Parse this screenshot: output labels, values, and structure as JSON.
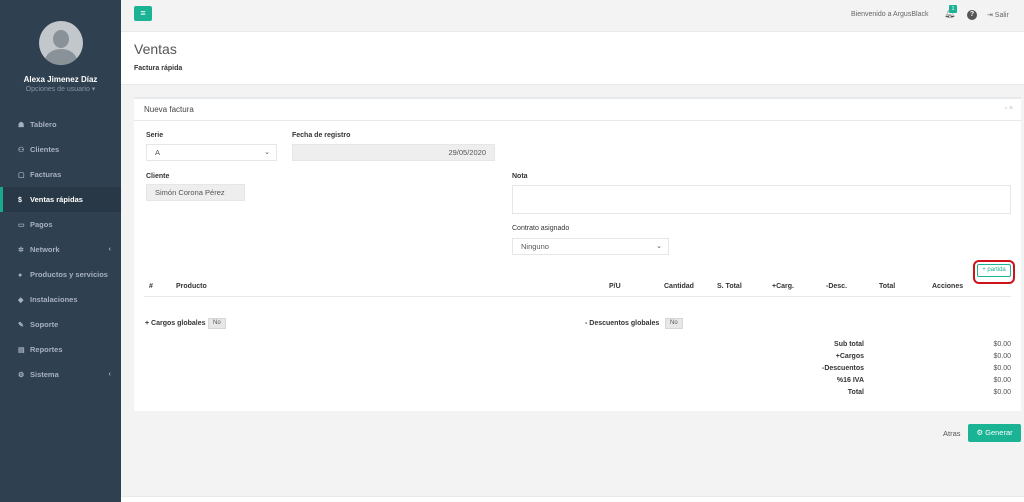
{
  "user": {
    "name": "Alexa Jimenez Díaz",
    "options": "Opciones de usuario ▾"
  },
  "nav": [
    {
      "icon": "☗",
      "label": "Tablero",
      "active": false,
      "arrow": ""
    },
    {
      "icon": "⚇",
      "label": "Clientes",
      "active": false,
      "arrow": ""
    },
    {
      "icon": "▢",
      "label": "Facturas",
      "active": false,
      "arrow": ""
    },
    {
      "icon": "$",
      "label": "Ventas rápidas",
      "active": true,
      "arrow": ""
    },
    {
      "icon": "▭",
      "label": "Pagos",
      "active": false,
      "arrow": ""
    },
    {
      "icon": "✲",
      "label": "Network",
      "active": false,
      "arrow": "‹"
    },
    {
      "icon": "●",
      "label": "Productos y servicios",
      "active": false,
      "arrow": ""
    },
    {
      "icon": "◆",
      "label": "Instalaciones",
      "active": false,
      "arrow": ""
    },
    {
      "icon": "✎",
      "label": "Soporte",
      "active": false,
      "arrow": ""
    },
    {
      "icon": "▤",
      "label": "Reportes",
      "active": false,
      "arrow": ""
    },
    {
      "icon": "⚙",
      "label": "Sistema",
      "active": false,
      "arrow": "‹"
    }
  ],
  "topbar": {
    "menu_icon": "≡",
    "welcome": "Bienvenido a ArgusBlack",
    "badge": "1",
    "help": "?",
    "logout": "⇥ Salir"
  },
  "header": {
    "title": "Ventas",
    "breadcrumb": "Factura rápida"
  },
  "card": {
    "title": "Nueva factura",
    "tools": "▫ ×"
  },
  "form": {
    "serie_label": "Serie",
    "serie_value": "A",
    "fecha_label": "Fecha de registro",
    "fecha_value": "29/05/2020",
    "cliente_label": "Cliente",
    "cliente_value": "Simón Corona Pérez",
    "nota_label": "Nota",
    "contrato_label": "Contrato asignado",
    "contrato_value": "Ninguno",
    "partida_label": "+ partida"
  },
  "table": {
    "headers": [
      "#",
      "Producto",
      "P/U",
      "Cantidad",
      "S. Total",
      "+Carg.",
      "-Desc.",
      "Total",
      "Acciones"
    ]
  },
  "globals": {
    "cargos_label": "+ Cargos globales",
    "cargos_value": "No",
    "descuentos_label": "- Descuentos globales",
    "descuentos_value": "No"
  },
  "totals": [
    {
      "label": "Sub total",
      "value": "$0.00"
    },
    {
      "label": "+Cargos",
      "value": "$0.00"
    },
    {
      "label": "-Descuentos",
      "value": "$0.00"
    },
    {
      "label": "%16 IVA",
      "value": "$0.00"
    },
    {
      "label": "Total",
      "value": "$0.00"
    }
  ],
  "footer": {
    "atras": "Atras",
    "generar": "⚙ Generar"
  },
  "colors": {
    "accent": "#1ab394",
    "sidebar": "#2f4050",
    "highlight": "#d0121b"
  }
}
